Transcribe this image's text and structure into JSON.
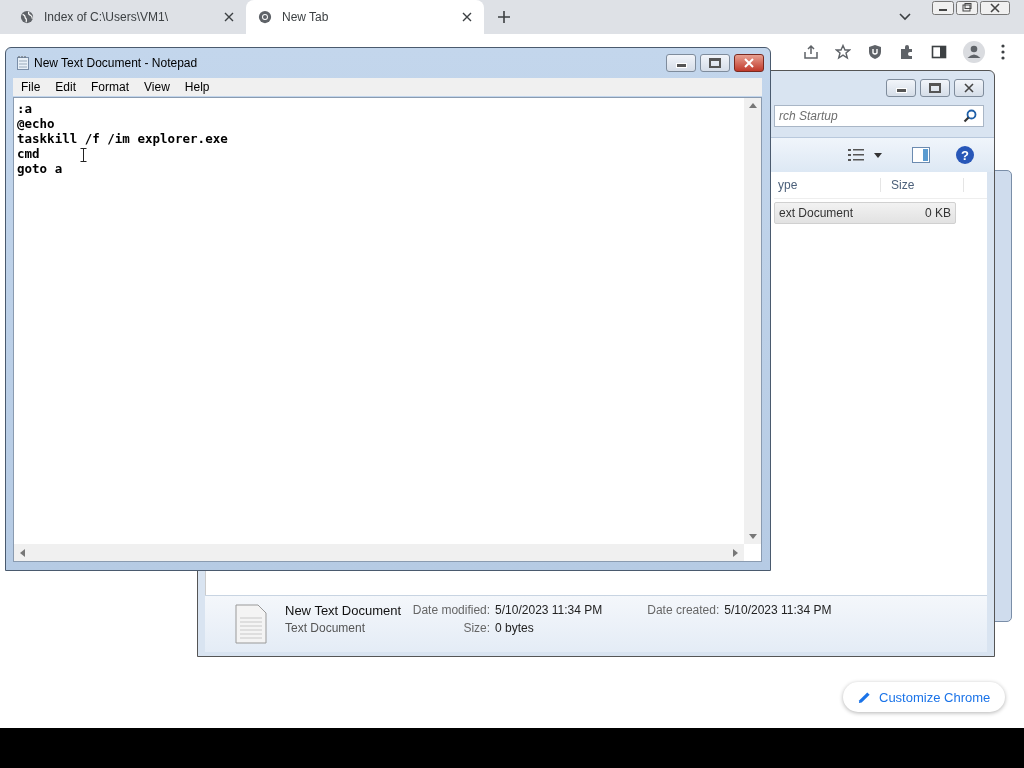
{
  "browser": {
    "tabs": [
      {
        "title": "Index of C:\\Users\\VM1\\",
        "selected": false
      },
      {
        "title": "New Tab",
        "selected": true
      }
    ],
    "customize_button": "Customize Chrome"
  },
  "explorer": {
    "search_placeholder": "rch Startup",
    "help_button": "?",
    "columns": [
      "ype",
      "Size"
    ],
    "rows": [
      {
        "type": "ext Document",
        "size": "0 KB",
        "selected": true
      }
    ],
    "details": {
      "name": "New Text Document",
      "type": "Text Document",
      "fields": [
        {
          "label": "Date modified:",
          "value": "5/10/2023 11:34 PM"
        },
        {
          "label": "Date created:",
          "value": "5/10/2023 11:34 PM"
        },
        {
          "label": "Size:",
          "value": "0 bytes"
        }
      ]
    }
  },
  "notepad": {
    "title": "New Text Document - Notepad",
    "menu": [
      "File",
      "Edit",
      "Format",
      "View",
      "Help"
    ],
    "lines": [
      ":a",
      "@echo",
      "taskkill /f /im explorer.exe",
      "cmd",
      "goto a"
    ]
  }
}
